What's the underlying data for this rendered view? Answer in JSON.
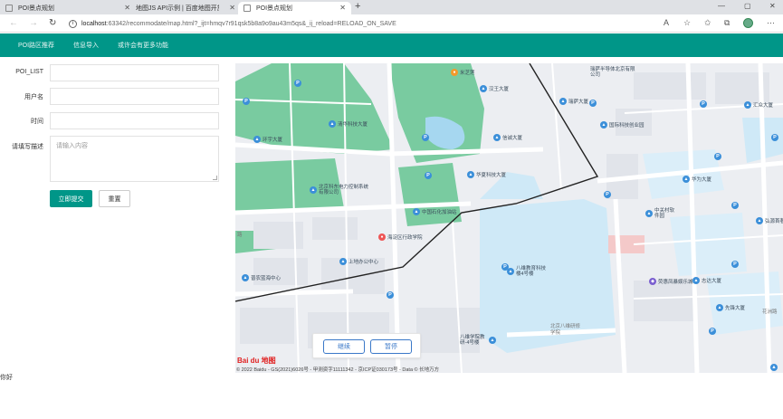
{
  "browser": {
    "tabs": [
      {
        "title": "POI景点规划",
        "icon": "page-icon"
      },
      {
        "title": "地图JS API示例 | 百度地图开放平",
        "icon": "map-pin-icon"
      },
      {
        "title": "POI景点规划",
        "icon": "page-icon"
      }
    ],
    "new_tab": "+",
    "window_controls": [
      "—",
      "▢",
      "✕"
    ],
    "url_host": "localhost",
    "url_rest": ":63342/recommodate/map.html?_ijt=hmqv7r91qsk5b8a9o9au43m5qs&_ij_reload=RELOAD_ON_SAVE",
    "info_icon": "i"
  },
  "nav": {
    "items": [
      "POI路区推荐",
      "信息导入",
      "或许会有更多功能"
    ]
  },
  "form": {
    "labels": {
      "poi": "POI_LIST",
      "user": "用户名",
      "time": "时间",
      "desc": "请填写描述"
    },
    "desc_placeholder": "请输入内容",
    "submit": "立即提交",
    "reset": "重置"
  },
  "footer_text": "你好",
  "map": {
    "pois": [
      {
        "name": "米芝莲",
        "icon": "orange"
      },
      {
        "name": "汉王大厦",
        "icon": "blue"
      },
      {
        "name": "瑞萨大厦",
        "icon": "blue"
      },
      {
        "name": "瑞萨半导体北京有限公司",
        "icon": "blue"
      },
      {
        "name": "国际科技创业园",
        "icon": "blue"
      },
      {
        "name": "汇众大厦",
        "icon": "blue"
      },
      {
        "name": "环宇大厦",
        "icon": "blue"
      },
      {
        "name": "清华科技大厦",
        "icon": "blue"
      },
      {
        "name": "信诚大厦",
        "icon": "blue"
      },
      {
        "name": "华夏科技大厦",
        "icon": "blue"
      },
      {
        "name": "北京科东电力控制系统有限公司",
        "icon": "blue"
      },
      {
        "name": "中国石化加油站",
        "icon": "blue"
      },
      {
        "name": "海淀区行政学院",
        "icon": "red"
      },
      {
        "name": "上地办公中心",
        "icon": "blue"
      },
      {
        "name": "普农蓝海中心",
        "icon": "blue"
      },
      {
        "name": "华为大厦",
        "icon": "blue"
      },
      {
        "name": "中关村软件园",
        "icon": "blue"
      },
      {
        "name": "弘源首著",
        "icon": "blue"
      },
      {
        "name": "八维教育科技楼4号楼",
        "icon": "blue"
      },
      {
        "name": "荧惠凤暴娱乐城",
        "icon": "purple"
      },
      {
        "name": "志达大厦",
        "icon": "blue"
      },
      {
        "name": "先锋大厦",
        "icon": "blue"
      },
      {
        "name": "八维学院教研-4号楼",
        "icon": "blue"
      }
    ],
    "road_labels": [
      "路",
      "北京八维研修学院",
      "花洲路"
    ],
    "parking": "P",
    "controls": {
      "continue": "继续",
      "pause": "暂停"
    },
    "logo": "Bai du 地图",
    "copyright": "© 2022 Baidu - GS(2021)6026号 - 甲测资字11111342 - 京ICP证030173号 - Data © 长地万方"
  }
}
